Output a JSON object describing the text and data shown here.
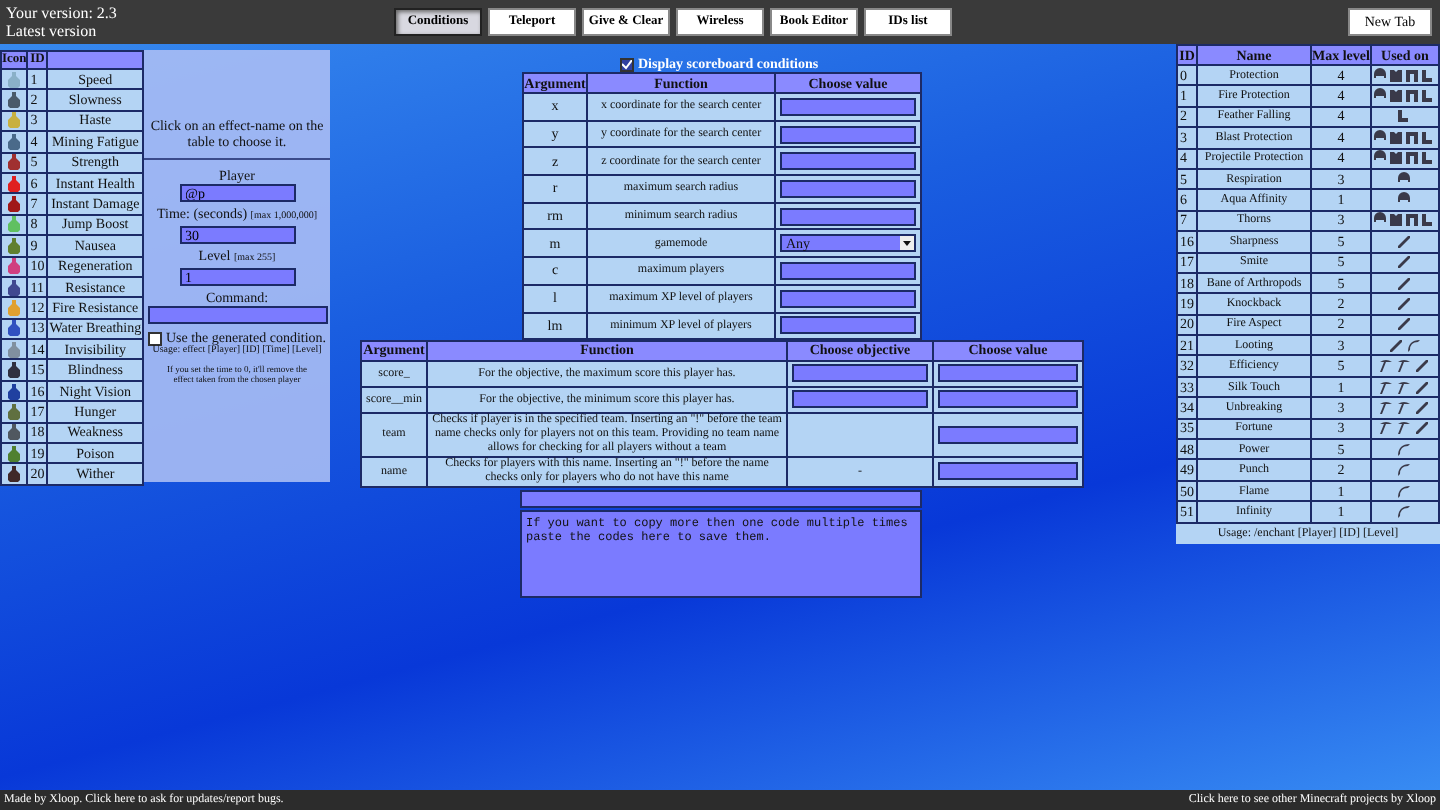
{
  "header": {
    "version": "Your version: 2.3",
    "latest": "Latest version"
  },
  "tabs": [
    {
      "label": "Conditions",
      "selected": true
    },
    {
      "label": "Teleport",
      "selected": false
    },
    {
      "label": "Give & Clear",
      "selected": false
    },
    {
      "label": "Wireless",
      "selected": false
    },
    {
      "label": "Book Editor",
      "selected": false
    },
    {
      "label": "IDs list",
      "selected": false
    }
  ],
  "new_tab": "New Tab",
  "effects": {
    "columns": [
      "Icon",
      "ID"
    ],
    "rows": [
      {
        "id": "1",
        "name": "Speed",
        "color": "#8ab0c8"
      },
      {
        "id": "2",
        "name": "Slowness",
        "color": "#4a5a6a"
      },
      {
        "id": "3",
        "name": "Haste",
        "color": "#c8b040"
      },
      {
        "id": "4",
        "name": "Mining Fatigue",
        "color": "#4a6a8a"
      },
      {
        "id": "5",
        "name": "Strength",
        "color": "#a03030"
      },
      {
        "id": "6",
        "name": "Instant Health",
        "color": "#e02020"
      },
      {
        "id": "7",
        "name": "Instant Damage",
        "color": "#a01818"
      },
      {
        "id": "8",
        "name": "Jump Boost",
        "color": "#60c060"
      },
      {
        "id": "9",
        "name": "Nausea",
        "color": "#608030"
      },
      {
        "id": "10",
        "name": "Regeneration",
        "color": "#d04080"
      },
      {
        "id": "11",
        "name": "Resistance",
        "color": "#404890"
      },
      {
        "id": "12",
        "name": "Fire Resistance",
        "color": "#e0a030"
      },
      {
        "id": "13",
        "name": "Water Breathing",
        "color": "#3050c0"
      },
      {
        "id": "14",
        "name": "Invisibility",
        "color": "#8090a0"
      },
      {
        "id": "15",
        "name": "Blindness",
        "color": "#303040"
      },
      {
        "id": "16",
        "name": "Night Vision",
        "color": "#2040a0"
      },
      {
        "id": "17",
        "name": "Hunger",
        "color": "#607040"
      },
      {
        "id": "18",
        "name": "Weakness",
        "color": "#505860"
      },
      {
        "id": "19",
        "name": "Poison",
        "color": "#508030"
      },
      {
        "id": "20",
        "name": "Wither",
        "color": "#402828"
      }
    ]
  },
  "effect_panel": {
    "hint": "Click on an effect-name on the table to choose it.",
    "player_label": "Player",
    "player_value": "@p",
    "time_label": "Time: (seconds)",
    "time_note": "[max 1,000,000]",
    "time_value": "30",
    "level_label": "Level",
    "level_note": "[max 255]",
    "level_value": "1",
    "command_label": "Command:",
    "use_condition": {
      "label": "Use the generated condition.",
      "checked": false
    },
    "usage": "Usage: effect [Player] [ID] [Time] [Level]",
    "note": "If you set the time to 0, it'll remove the effect taken from the chosen player"
  },
  "scoreboard_toggle": {
    "label": "Display scoreboard conditions",
    "checked": true
  },
  "conditions": {
    "columns": [
      "Argument",
      "Function",
      "Choose value"
    ],
    "rows": [
      {
        "argument": "x",
        "function": "x coordinate for the search center",
        "kind": "field"
      },
      {
        "argument": "y",
        "function": "y coordinate for the search center",
        "kind": "field"
      },
      {
        "argument": "z",
        "function": "z coordinate for the search center",
        "kind": "field"
      },
      {
        "argument": "r",
        "function": "maximum search radius",
        "kind": "field"
      },
      {
        "argument": "rm",
        "function": "minimum search radius",
        "kind": "field"
      },
      {
        "argument": "m",
        "function": "gamemode",
        "kind": "select",
        "value": "Any"
      },
      {
        "argument": "c",
        "function": "maximum players",
        "kind": "field"
      },
      {
        "argument": "l",
        "function": "maximum XP level of players",
        "kind": "field"
      },
      {
        "argument": "lm",
        "function": "minimum XP level of players",
        "kind": "field"
      }
    ]
  },
  "scoreboard": {
    "columns": [
      "Argument",
      "Function",
      "Choose objective",
      "Choose value"
    ],
    "rows": [
      {
        "argument": "score_",
        "function": "For the objective, the maximum score this player has.",
        "objective_field": true
      },
      {
        "argument": "score__min",
        "function": "For the objective, the minimum score this player has.",
        "objective_field": true
      },
      {
        "argument": "team",
        "function": "Checks if player is in the specified team. Inserting an \"!\" before the team name checks only for players not on this team. Providing no team name allows for checking for all players without a team",
        "objective_field": false
      },
      {
        "argument": "name",
        "function": "Checks for players with this name. Inserting an \"!\" before the name checks only for players who do not have this name",
        "objective_field": false,
        "objective_text": "-"
      }
    ]
  },
  "notes": {
    "placeholder": "If you want to copy more then one code multiple times paste the codes here to save them."
  },
  "enchantments": {
    "columns": [
      "ID",
      "Name",
      "Max level",
      "Used on"
    ],
    "rows": [
      {
        "id": "0",
        "name": "Protection",
        "max": "4",
        "kind": "armor"
      },
      {
        "id": "1",
        "name": "Fire Protection",
        "max": "4",
        "kind": "armor"
      },
      {
        "id": "2",
        "name": "Feather Falling",
        "max": "4",
        "kind": "boots"
      },
      {
        "id": "3",
        "name": "Blast Protection",
        "max": "4",
        "kind": "armor"
      },
      {
        "id": "4",
        "name": "Projectile Protection",
        "max": "4",
        "kind": "armor"
      },
      {
        "id": "5",
        "name": "Respiration",
        "max": "3",
        "kind": "helmet"
      },
      {
        "id": "6",
        "name": "Aqua Affinity",
        "max": "1",
        "kind": "helmet"
      },
      {
        "id": "7",
        "name": "Thorns",
        "max": "3",
        "kind": "armor"
      },
      {
        "id": "16",
        "name": "Sharpness",
        "max": "5",
        "kind": "sword"
      },
      {
        "id": "17",
        "name": "Smite",
        "max": "5",
        "kind": "sword"
      },
      {
        "id": "18",
        "name": "Bane of Arthropods",
        "max": "5",
        "kind": "sword"
      },
      {
        "id": "19",
        "name": "Knockback",
        "max": "2",
        "kind": "sword"
      },
      {
        "id": "20",
        "name": "Fire Aspect",
        "max": "2",
        "kind": "sword"
      },
      {
        "id": "21",
        "name": "Looting",
        "max": "3",
        "kind": "weapons"
      },
      {
        "id": "32",
        "name": "Efficiency",
        "max": "5",
        "kind": "tools"
      },
      {
        "id": "33",
        "name": "Silk Touch",
        "max": "1",
        "kind": "tools"
      },
      {
        "id": "34",
        "name": "Unbreaking",
        "max": "3",
        "kind": "tools"
      },
      {
        "id": "35",
        "name": "Fortune",
        "max": "3",
        "kind": "tools"
      },
      {
        "id": "48",
        "name": "Power",
        "max": "5",
        "kind": "bow"
      },
      {
        "id": "49",
        "name": "Punch",
        "max": "2",
        "kind": "bow"
      },
      {
        "id": "50",
        "name": "Flame",
        "max": "1",
        "kind": "bow"
      },
      {
        "id": "51",
        "name": "Infinity",
        "max": "1",
        "kind": "bow"
      }
    ],
    "usage": "Usage: /enchant [Player] [ID] [Level]"
  },
  "footer": {
    "left": "Made by Xloop. Click here to ask for updates/report bugs.",
    "right": "Click here to see other Minecraft projects by Xloop"
  }
}
